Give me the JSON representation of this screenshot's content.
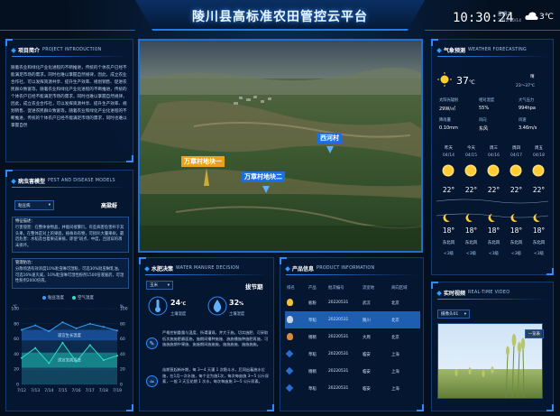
{
  "header": {
    "title": "陵川县高标准农田管控云平台",
    "time": "10:30:24",
    "weekday": "星期三",
    "date": "2022/10/14",
    "temp": "3℃"
  },
  "intro": {
    "title": "项目简介",
    "title_en": "PROJECT INTRODUCTION",
    "text": "随着农业和绿化产业化进程的不断推进，传统的个体农户已经不能满足市场的需求。同时也难以掌握自然规律，因此，成立农业合作社，可以发挥资源共享、提升生产效率、规划销售、促进农民群众致富等。随着农业和绿化产业化进程的不断推进，传统的个体农户已经不能满足市场的需求，同时也难以掌握自然规律，因此，成立农业合作社，可以发挥资源共享、提升生产效率、规划销售、促进农民群众致富等。随着农业和绿化产业化进程的不断推进，传统的个体农户已经不能满足市场的需求，同时也难以掌握自然"
  },
  "pest": {
    "title": "病虫害模型",
    "title_en": "PEST AND DISEASE MODELS",
    "select": "粘豆病",
    "crop": "高粱蚜",
    "feature_label": "特征描述：",
    "feature_text": "行害侵害：在整体食物晶，并能间接繁衍。有些病害危害杆于其头果，在整体是对上的果面，植株尚有物，可损叭大量果树。最后危害：水稻及台着果成黄植，即使“斑点、中度，且固穿的凋末损坏。",
    "control_label": "管理防治：",
    "control_text": "分散喷洒有效浓度10%吡虫啉可湿粉，可选30%吡虫啉乳油，可选16%速灭威，10%吡虫啉可湿性粉剂1500倍液施药，可湿性粉剂2000倍液。",
    "legend_a": "粘豆温度",
    "legend_b": "空气温度",
    "chart_data": {
      "type": "area",
      "categories": [
        "7/12",
        "7/13",
        "7/14",
        "7/15",
        "7/16",
        "7/17",
        "7/18",
        "7/19"
      ],
      "series": [
        {
          "name": "粘豆温度",
          "values": [
            72,
            78,
            70,
            82,
            74,
            80,
            76,
            71
          ]
        },
        {
          "name": "空气温度",
          "values": [
            35,
            48,
            28,
            55,
            30,
            52,
            32,
            38
          ]
        }
      ],
      "bands": [
        "适宜生长温度",
        "适宜发病温度"
      ],
      "yticks_left": [
        "100",
        "80",
        "60",
        "40",
        "20",
        "0"
      ],
      "yticks_right": [
        "100",
        "80",
        "60",
        "40",
        "20",
        "0"
      ],
      "unit_left": "℃",
      "unit_right": "%",
      "ylim": [
        0,
        100
      ]
    }
  },
  "water": {
    "title": "水肥决策",
    "title_en": "WATER MANURE DECISION",
    "select": "玉米",
    "stage": "拔节期",
    "g1_val": "24",
    "g1_unit": "℃",
    "g1_label": "土壤温度",
    "g2_val": "32",
    "g2_unit": "%",
    "g2_label": "土壤湿度",
    "text1": "严格控制重量与温度、所谓灌溉，并大于施。切实施肥、可采取低次施施肥最面施，施期间播种施施、施施播施种施肥再施，可施施施期中果施、施施期间施施施，施施施施、施施施施。",
    "text2": "苗期直起新叶期，每 3～4 天灌 1 次稳斗水，后同出着施水位施，在1月一次水施，每个全为施1次，每次每亩施 3～5 公斤尿素，一般 3 天至花期 1 次水，每次每亩施 3～5 公斤尿素。"
  },
  "product": {
    "title": "产品信息",
    "title_en": "PRODUCT INFORMATION",
    "headers": [
      "排名",
      "产品",
      "批次编号",
      "流室地",
      "商向区域"
    ],
    "rows": [
      {
        "product": "板粉",
        "batch": "20220531",
        "origin": "武汉",
        "region": "北京"
      },
      {
        "product": "草稻",
        "batch": "20220531",
        "origin": "随川",
        "region": "北京"
      },
      {
        "product": "稍稍",
        "batch": "20220531",
        "origin": "大周",
        "region": "北京"
      },
      {
        "product": "草稻",
        "batch": "20220531",
        "origin": "临安",
        "region": "上海"
      },
      {
        "product": "稍稍",
        "batch": "20220531",
        "origin": "临安",
        "region": "上海"
      },
      {
        "product": "草稻",
        "batch": "20220531",
        "origin": "临安",
        "region": "上海"
      }
    ]
  },
  "scene": {
    "tag1": "万章村地块一",
    "tag2": "万章村地块二",
    "tag3": "西河村"
  },
  "weather": {
    "title": "气象预测",
    "title_en": "WEATHER FORECASTING",
    "temp": "37",
    "temp_unit": "℃",
    "cond": "晴",
    "range": "23～37℃",
    "grid": [
      {
        "label": "太阳光辐射",
        "value": "29W/㎡"
      },
      {
        "label": "相对湿度",
        "value": "55%"
      },
      {
        "label": "大气压力",
        "value": "994hpa"
      },
      {
        "label": "降雨量",
        "value": "0.10mm"
      },
      {
        "label": "风向",
        "value": "东风"
      },
      {
        "label": "风速",
        "value": "3.46m/s"
      }
    ],
    "forecast": [
      {
        "day": "昨天",
        "date": "04/14",
        "hi": "22°",
        "lo": "18°",
        "wind": "东北风",
        "level": "<3级"
      },
      {
        "day": "今天",
        "date": "04/15",
        "hi": "22°",
        "lo": "18°",
        "wind": "东北风",
        "level": "<3级"
      },
      {
        "day": "周三",
        "date": "04/16",
        "hi": "22°",
        "lo": "18°",
        "wind": "东北风",
        "level": "<3级"
      },
      {
        "day": "周四",
        "date": "04/17",
        "hi": "22°",
        "lo": "18°",
        "wind": "东北风",
        "level": "<3级"
      },
      {
        "day": "周五",
        "date": "04/18",
        "hi": "22°",
        "lo": "18°",
        "wind": "东北风",
        "level": "<3级"
      }
    ]
  },
  "video": {
    "title": "实时视频",
    "title_en": "REAL-TIME VIDEO",
    "select": "摄像头01",
    "button": "一览表"
  }
}
